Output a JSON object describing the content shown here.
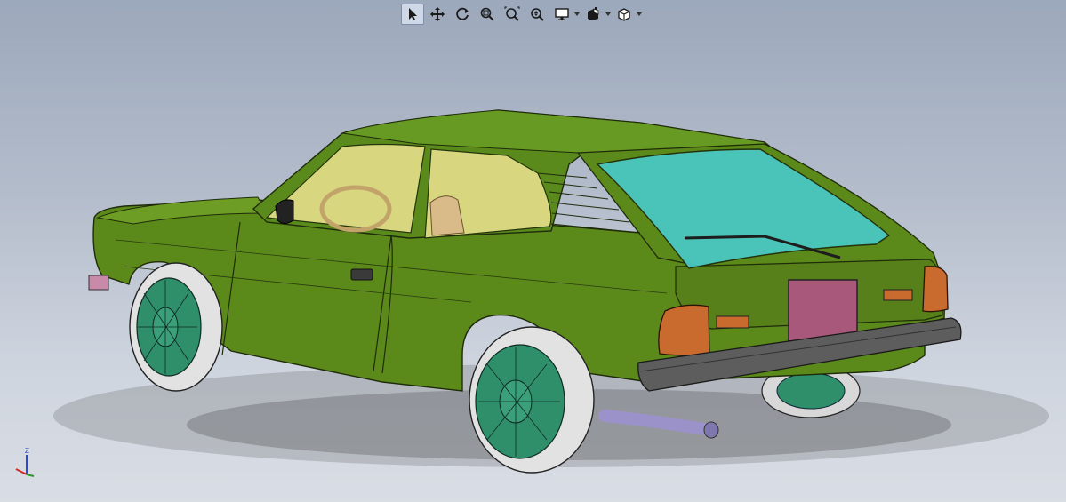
{
  "viewport": {
    "background_top": "#9ca8bb",
    "background_bottom": "#d9dde4"
  },
  "toolbar": {
    "buttons": [
      {
        "id": "select",
        "icon": "select-arrow-icon",
        "active": true
      },
      {
        "id": "pan",
        "icon": "pan-icon",
        "active": false
      },
      {
        "id": "rotate",
        "icon": "rotate-icon",
        "active": false
      },
      {
        "id": "zoom-to-fit",
        "icon": "zoom-to-fit-icon",
        "active": false
      },
      {
        "id": "zoom-to-area",
        "icon": "zoom-to-area-icon",
        "active": false
      },
      {
        "id": "zoom-in-out",
        "icon": "zoom-in-out-icon",
        "active": false
      },
      {
        "id": "display-style",
        "icon": "display-monitor-icon",
        "dropdown": true
      },
      {
        "id": "appearance",
        "icon": "appearance-icon",
        "dropdown": true
      },
      {
        "id": "view-orientation",
        "icon": "view-cube-icon",
        "dropdown": true
      }
    ]
  },
  "triad": {
    "z_label": "Z",
    "x_color": "#d22a2a",
    "y_color": "#2a9a2a",
    "z_color": "#2a4ad2"
  },
  "model": {
    "body_color": "#5b8a1b",
    "body_edge_color": "#1f2b0a",
    "glass_front_color": "#e6e08a",
    "glass_rear_color": "#49c8c6",
    "tire_color": "#e2e2e2",
    "rim_color": "#2f8f6b",
    "taillight_color": "#c96a2e",
    "plate_color": "#a8587a",
    "bumper_color": "#5d5d5d",
    "exhaust_color": "#9a92c8"
  }
}
